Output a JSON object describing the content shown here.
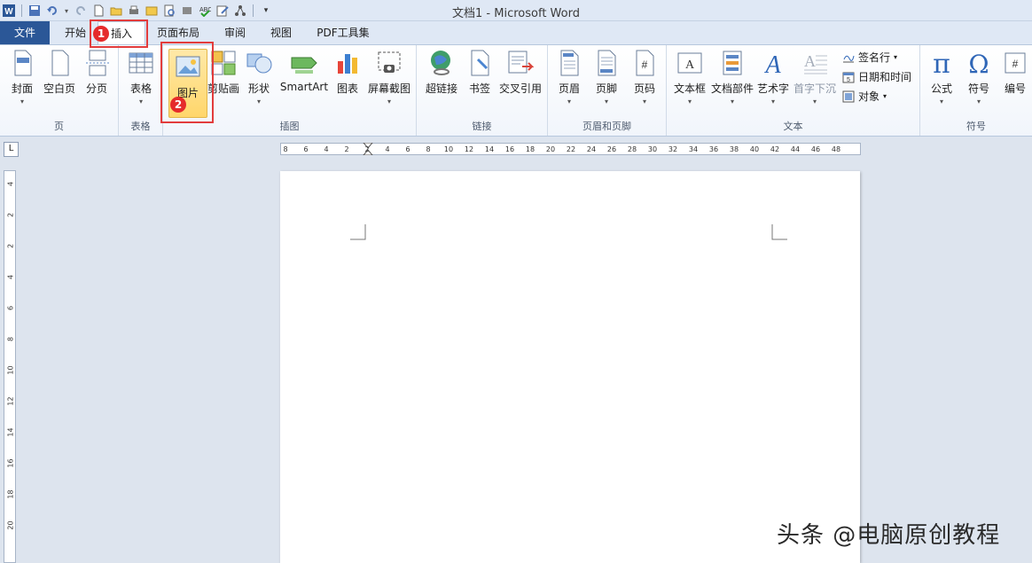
{
  "window": {
    "title": "文档1 - Microsoft Word"
  },
  "tabs": [
    {
      "id": "file",
      "label": "文件"
    },
    {
      "id": "home",
      "label": "开始"
    },
    {
      "id": "insert",
      "label": "插入"
    },
    {
      "id": "layout",
      "label": "页面布局"
    },
    {
      "id": "review",
      "label": "审阅"
    },
    {
      "id": "view",
      "label": "视图"
    },
    {
      "id": "pdf",
      "label": "PDF工具集"
    }
  ],
  "groups": {
    "pages": {
      "label": "页",
      "buttons": [
        "封面",
        "空白页",
        "分页"
      ]
    },
    "tables": {
      "label": "表格",
      "buttons": [
        "表格"
      ]
    },
    "illustrations": {
      "label": "插图",
      "buttons": [
        "图片",
        "剪贴画",
        "形状",
        "SmartArt",
        "图表",
        "屏幕截图"
      ]
    },
    "links": {
      "label": "链接",
      "buttons": [
        "超链接",
        "书签",
        "交叉引用"
      ]
    },
    "headerfooter": {
      "label": "页眉和页脚",
      "buttons": [
        "页眉",
        "页脚",
        "页码"
      ]
    },
    "text": {
      "label": "文本",
      "buttons": [
        "文本框",
        "文档部件",
        "艺术字",
        "首字下沉"
      ],
      "small": [
        "签名行",
        "日期和时间",
        "对象"
      ]
    },
    "symbols": {
      "label": "符号",
      "buttons": [
        "公式",
        "符号",
        "编号"
      ]
    }
  },
  "annotations": {
    "step1": "1",
    "step2": "2"
  },
  "ruler": {
    "h": [
      "8",
      "6",
      "4",
      "2",
      "2",
      "4",
      "6",
      "8",
      "10",
      "12",
      "14",
      "16",
      "18",
      "20",
      "22",
      "24",
      "26",
      "28",
      "30",
      "32",
      "34",
      "36",
      "38",
      "40",
      "42",
      "44",
      "46",
      "48"
    ],
    "v": [
      "4",
      "2",
      "2",
      "4",
      "6",
      "8",
      "10",
      "12",
      "14",
      "16",
      "18",
      "20"
    ]
  },
  "corner_glyph": "L",
  "watermark": "头条 @电脑原创教程",
  "colors": {
    "file_tab": "#2b5797",
    "annotation": "#e23c3c",
    "pressed": "#ffd66b"
  }
}
